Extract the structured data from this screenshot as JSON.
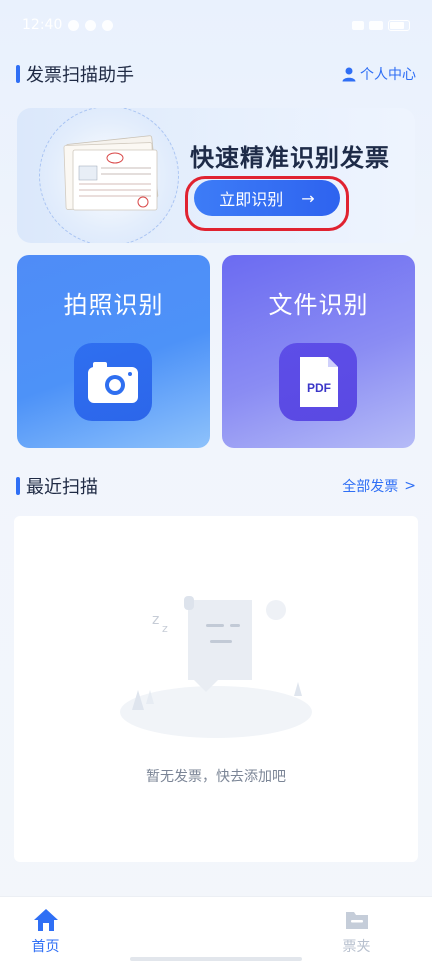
{
  "status_bar": {
    "time": "12:40"
  },
  "header": {
    "title": "发票扫描助手",
    "profile_label": "个人中心"
  },
  "hero": {
    "heading": "快速精准识别发票",
    "button_label": "立即识别",
    "button_arrow": "→"
  },
  "features": {
    "photo": {
      "label": "拍照识别"
    },
    "file": {
      "label": "文件识别",
      "icon_text": "PDF"
    }
  },
  "recent": {
    "title": "最近扫描",
    "all_label": "全部发票",
    "all_chevron": ">",
    "empty_text": "暂无发票，快去添加吧"
  },
  "bottom_nav": {
    "home_label": "首页",
    "folder_label": "票夹"
  },
  "colors": {
    "accent": "#2f6ff5",
    "highlight": "#e02230"
  }
}
